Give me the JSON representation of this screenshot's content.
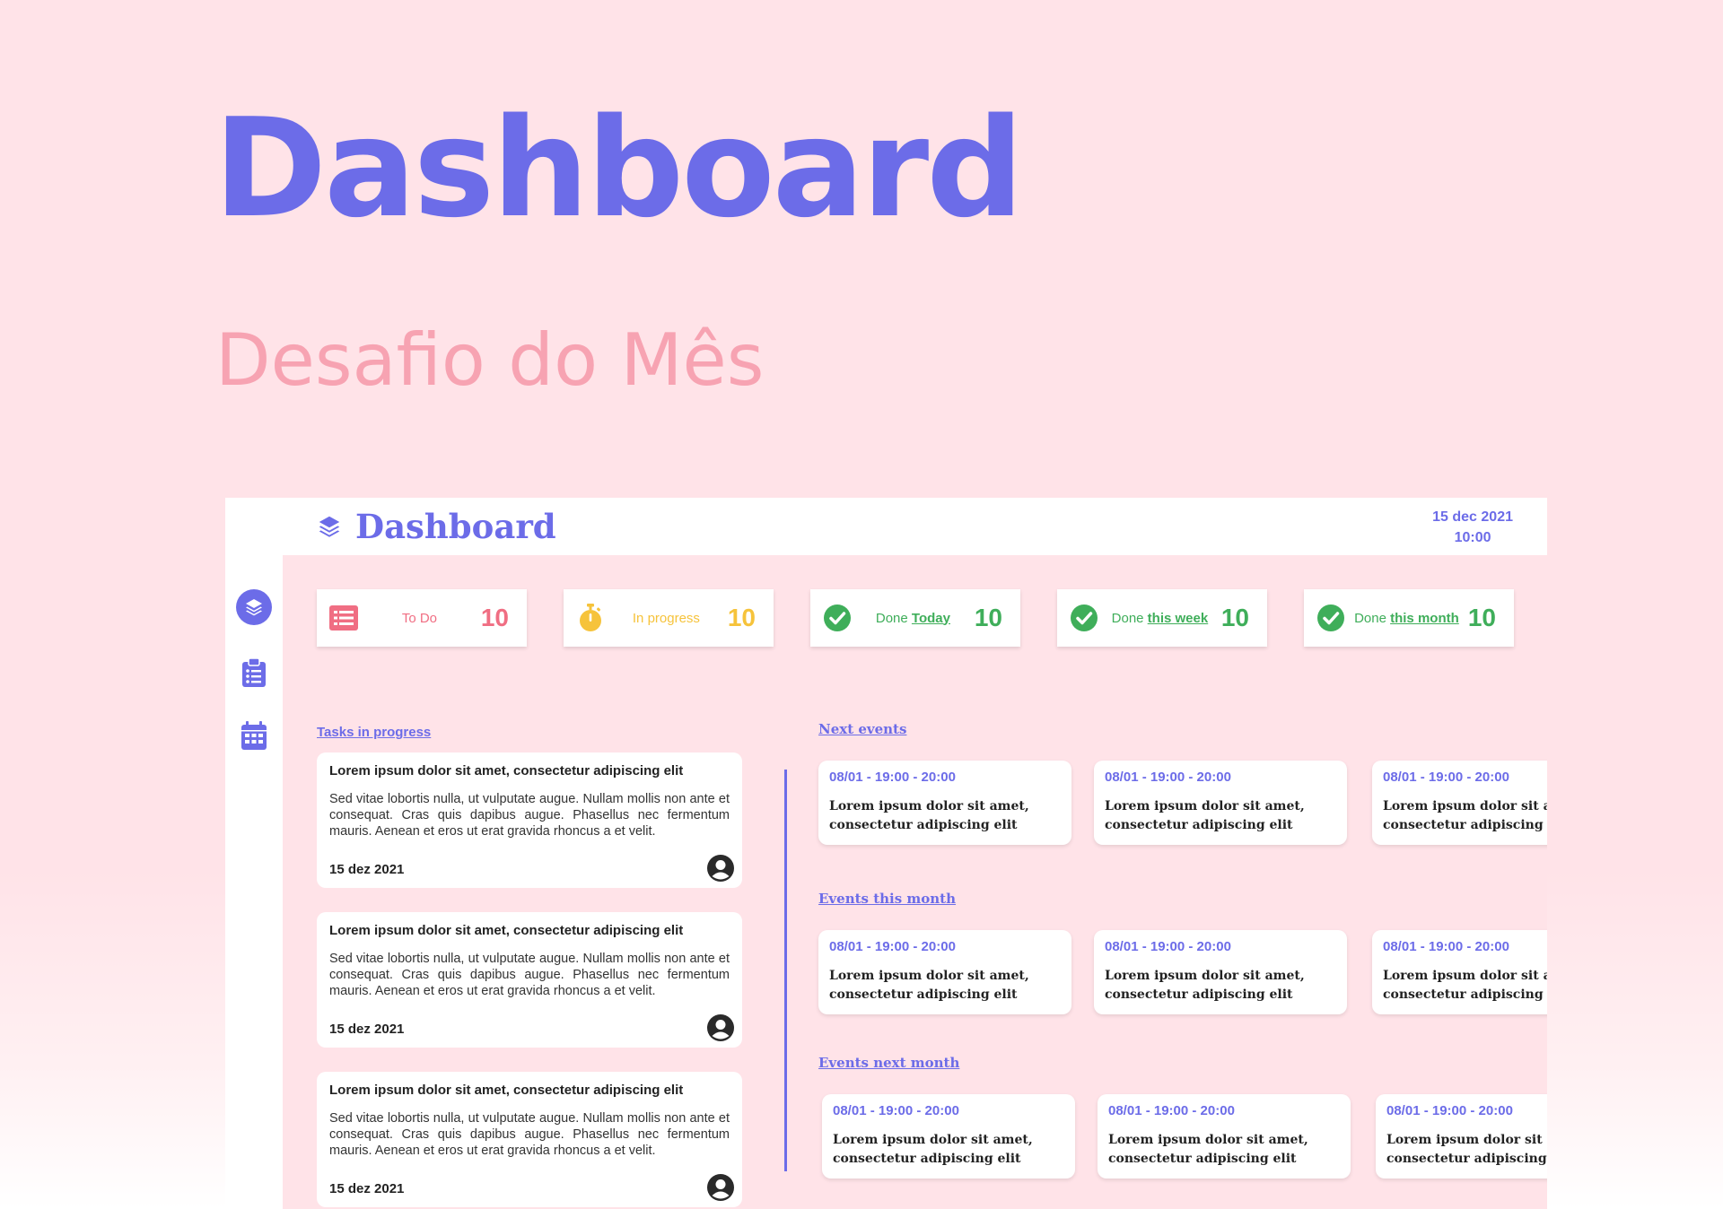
{
  "hero": {
    "title": "Dashboard",
    "subtitle": "Desafio do Mês"
  },
  "app": {
    "title": "Dashboard",
    "date": "15 dec 2021",
    "time": "10:00",
    "sidebar": [
      {
        "icon": "layers-icon",
        "active": true
      },
      {
        "icon": "clipboard-icon",
        "active": false
      },
      {
        "icon": "calendar-icon",
        "active": false
      }
    ],
    "stats": [
      {
        "label": "To Do",
        "label_highlight": "",
        "count": "10",
        "color": "#f06e83",
        "icon": "list-icon"
      },
      {
        "label": "In progress",
        "label_highlight": "",
        "count": "10",
        "color": "#f6c33b",
        "icon": "stopwatch-icon"
      },
      {
        "label": "Done",
        "label_highlight": "Today",
        "count": "10",
        "color": "#3fae5a",
        "icon": "check-circle-icon"
      },
      {
        "label": "Done",
        "label_highlight": "this week",
        "count": "10",
        "color": "#3fae5a",
        "icon": "check-circle-icon"
      },
      {
        "label": "Done",
        "label_highlight": "this month",
        "count": "10",
        "color": "#3fae5a",
        "icon": "check-circle-icon"
      }
    ],
    "tasks_label": "Tasks in progress",
    "tasks": [
      {
        "title": "Lorem ipsum dolor sit amet, consectetur adipiscing elit",
        "description": "Sed vitae lobortis nulla, ut vulputate augue. Nullam mollis non ante et consequat. Cras quis dapibus augue. Phasellus nec fermentum mauris. Aenean et eros ut erat gravida rhoncus a et velit.",
        "date": "15 dez 2021"
      },
      {
        "title": "Lorem ipsum dolor sit amet, consectetur adipiscing elit",
        "description": "Sed vitae lobortis nulla, ut vulputate augue. Nullam mollis non ante et consequat. Cras quis dapibus augue. Phasellus nec fermentum mauris. Aenean et eros ut erat gravida rhoncus a et velit.",
        "date": "15 dez 2021"
      },
      {
        "title": "Lorem ipsum dolor sit amet, consectetur adipiscing elit",
        "description": "Sed vitae lobortis nulla, ut vulputate augue. Nullam mollis non ante et consequat. Cras quis dapibus augue. Phasellus nec fermentum mauris. Aenean et eros ut erat gravida rhoncus a et velit.",
        "date": "15 dez 2021"
      }
    ],
    "event_sections": [
      {
        "label": "Next events",
        "events": [
          {
            "date": "08/01 - 19:00 - 20:00",
            "line1": "Lorem ipsum dolor sit amet,",
            "line2": "consectetur adipiscing elit"
          },
          {
            "date": "08/01 - 19:00 - 20:00",
            "line1": "Lorem ipsum dolor sit amet,",
            "line2": "consectetur adipiscing elit"
          },
          {
            "date": "08/01 - 19:00 - 20:00",
            "line1": "Lorem ipsum dolor sit amet,",
            "line2": "consectetur adipiscing elit"
          }
        ]
      },
      {
        "label": "Events this month",
        "events": [
          {
            "date": "08/01 - 19:00 - 20:00",
            "line1": "Lorem ipsum dolor sit amet,",
            "line2": "consectetur adipiscing elit"
          },
          {
            "date": "08/01 - 19:00 - 20:00",
            "line1": "Lorem ipsum dolor sit amet,",
            "line2": "consectetur adipiscing elit"
          },
          {
            "date": "08/01 - 19:00 - 20:00",
            "line1": "Lorem ipsum dolor sit amet,",
            "line2": "consectetur adipiscing elit"
          }
        ]
      },
      {
        "label": "Events next month",
        "events": [
          {
            "date": "08/01 - 19:00 - 20:00",
            "line1": "Lorem ipsum dolor sit amet,",
            "line2": "consectetur adipiscing elit"
          },
          {
            "date": "08/01 - 19:00 - 20:00",
            "line1": "Lorem ipsum dolor sit amet,",
            "line2": "consectetur adipiscing elit"
          },
          {
            "date": "08/01 - 19:00 - 20:00",
            "line1": "Lorem ipsum dolor sit amet,",
            "line2": "consectetur adipiscing elit"
          }
        ]
      }
    ],
    "colors": {
      "accent": "#6c6ce8",
      "background": "#ffe3e8",
      "subtitle": "#f7a3b2"
    }
  }
}
